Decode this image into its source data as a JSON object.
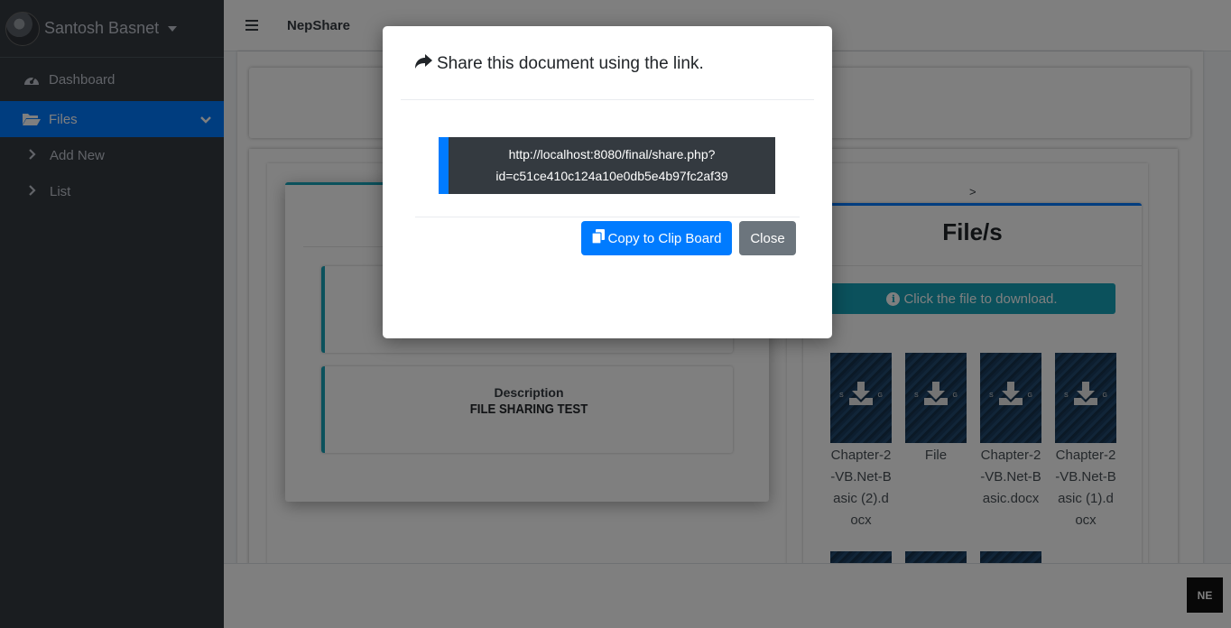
{
  "user": {
    "name": "Santosh Basnet"
  },
  "sidebar": {
    "items": [
      {
        "label": "Dashboard",
        "icon": "tachometer-icon"
      },
      {
        "label": "Files",
        "icon": "folder-open-icon",
        "active": true
      },
      {
        "label": "Add New",
        "icon": "chevron-right-icon"
      },
      {
        "label": "List",
        "icon": "chevron-right-icon"
      }
    ]
  },
  "navbar": {
    "brand": "NepShare"
  },
  "main": {
    "description_label": "Description",
    "description_value": "FILE SHARING TEST",
    "breadcrumb_mark": ">",
    "files_title": "File/s",
    "download_hint": "Click the file to download.",
    "thumb_text_left": "S",
    "thumb_text_right": "G",
    "files": [
      {
        "name": "Chapter-2-VB.Net-Basic (2).docx"
      },
      {
        "name": "File"
      },
      {
        "name": "Chapter-2-VB.Net-Basic.docx"
      },
      {
        "name": "Chapter-2-VB.Net-Basic (1).docx"
      }
    ]
  },
  "corner_logo": "NE",
  "modal": {
    "title": "Share this document using the link.",
    "link_line1": "http://localhost:8080/final/share.php?",
    "link_line2": "id=c51ce410c124a10e0db5e4b97fc2af39",
    "copy_label": "Copy to Clip Board",
    "close_label": "Close"
  },
  "colors": {
    "primary": "#007bff",
    "info": "#17a2b8",
    "secondary": "#6c757d",
    "sidebar": "#343a40"
  }
}
